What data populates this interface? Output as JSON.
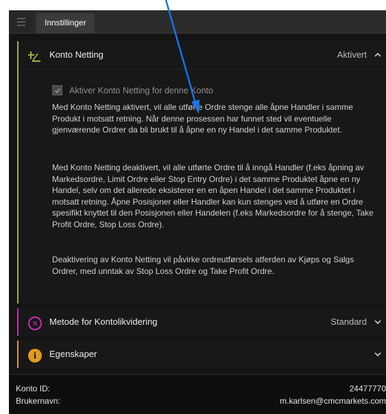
{
  "tab": {
    "label": "Innstillinger"
  },
  "netting": {
    "title": "Konto Netting",
    "status": "Aktivert",
    "checkbox_label": "Aktiver Konto Netting for denne Konto",
    "paragraph1": "Med Konto Netting aktivert, vil alle utførte Ordre stenge alle åpne Handler i samme Produkt i motsatt retning. Når denne prosessen har funnet sted vil eventuelle gjenværende Ordrer da bli brukt til å åpne en ny Handel i det samme Produktet.",
    "paragraph2": "Med Konto Netting deaktivert, vil alle utførte Ordre til å inngå Handler (f.eks åpning av Markedsordre, Limit Ordre eller Stop Entry Ordre) i det samme Produktet åpne en ny Handel, selv om det allerede eksisterer en en åpen Handel i det samme Produktet i motsatt retning. Åpne Posisjoner eller Handler kan kun stenges ved å utføre en Ordre spesifikt knyttet til den Posisjonen eller Handelen (f.eks Markedsordre for å stenge, Take Profit Ordre, Stop Loss Ordre).",
    "paragraph3": "Deaktivering av Konto Netting vil påvirke ordreutførsels atferden av Kjøps og Salgs Ordrer, med unntak av Stop Loss Ordre og Take Profit Ordre.",
    "checked": true
  },
  "liquidation": {
    "title": "Metode for Kontolikvidering",
    "status": "Standard"
  },
  "properties": {
    "title": "Egenskaper"
  },
  "footer": {
    "account_label": "Konto ID:",
    "account_value": "24477770",
    "username_label": "Brukernavn:",
    "username_value": "m.karlsen@cmcmarkets.com"
  },
  "icons": {
    "netting": "netting-icon",
    "liquidation": "circle-x-icon",
    "properties": "info-icon",
    "menu": "hamburger-icon"
  },
  "colors": {
    "netting_accent": "#9fb23a",
    "liquidation_accent": "#c92fb8",
    "properties_accent": "#e19a21",
    "annotation_arrow": "#1a73e8"
  }
}
